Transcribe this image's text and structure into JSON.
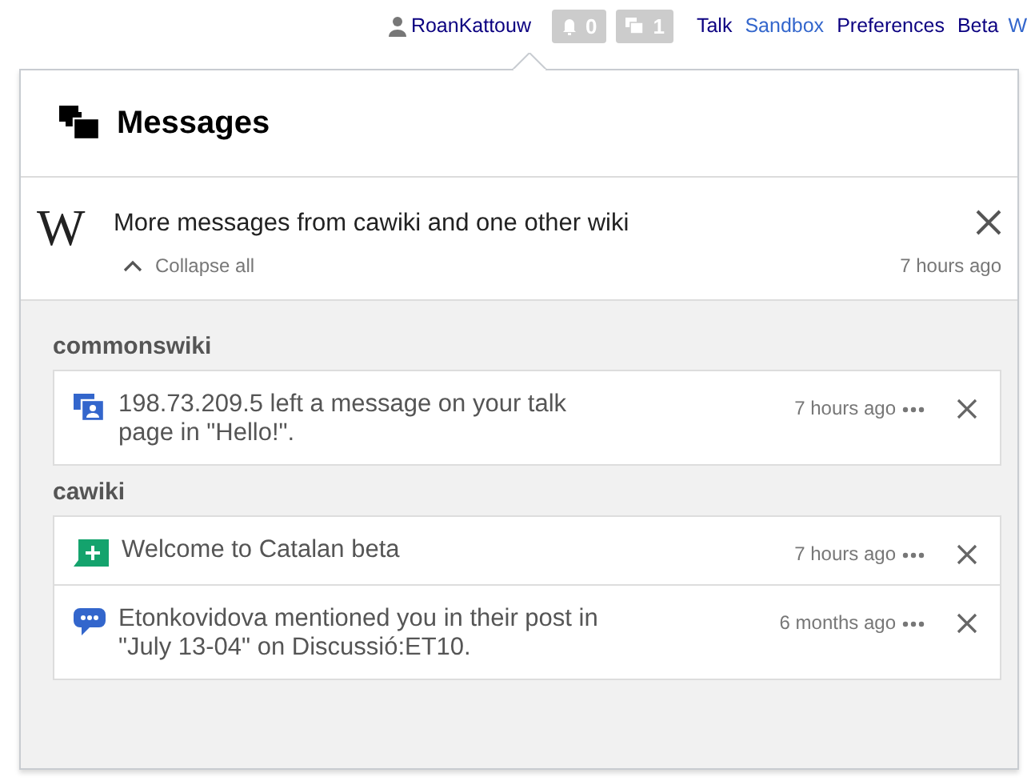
{
  "personal_bar": {
    "user": "RoanKattouw",
    "badges": [
      {
        "kind": "alerts",
        "count": "0"
      },
      {
        "kind": "messages",
        "count": "1"
      }
    ],
    "links": [
      {
        "label": "Talk",
        "visited": true
      },
      {
        "label": "Sandbox",
        "visited": false
      },
      {
        "label": "Preferences",
        "visited": true
      },
      {
        "label": "Beta",
        "visited": true
      },
      {
        "label": "W",
        "visited": false
      }
    ]
  },
  "popup": {
    "title": "Messages",
    "bundle": {
      "logo": "W",
      "text": "More messages from cawiki and one other wiki",
      "collapse": "Collapse all",
      "time": "7 hours ago"
    },
    "groups": [
      {
        "name": "commonswiki",
        "items": [
          {
            "kind": "talk",
            "text": "198.73.209.5 left a message on your talk page in \"Hello!\".",
            "time": "7 hours ago"
          }
        ]
      },
      {
        "name": "cawiki",
        "items": [
          {
            "kind": "welcome",
            "text": "Welcome to Catalan beta",
            "time": "7 hours ago"
          },
          {
            "kind": "mention",
            "text": "Etonkovidova mentioned you in their post in \"July 13-04\" on Discussió:ET10.",
            "time": "6 months ago"
          }
        ]
      }
    ]
  }
}
